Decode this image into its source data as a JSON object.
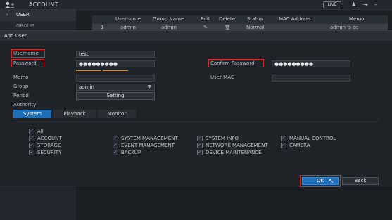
{
  "topbar": {
    "title": "ACCOUNT",
    "live_badge": "LIVE",
    "icons": [
      "account-icon",
      "user-icon",
      "exit-icon",
      "minimize-icon"
    ]
  },
  "sidebar": {
    "items": [
      {
        "label": "USER",
        "chevron": "›"
      },
      {
        "label": "GROUP"
      }
    ]
  },
  "bg_table": {
    "columns": [
      "",
      "Username",
      "Group Name",
      "Edit",
      "Delete",
      "Status",
      "MAC Address",
      "Memo"
    ],
    "rows": [
      [
        "1",
        "admin",
        "admin",
        "✎",
        "🗑",
        "Normal",
        "",
        "admin 's ac"
      ]
    ]
  },
  "dialog": {
    "title": "Add User",
    "labels": {
      "username": "Username",
      "password": "Password",
      "memo": "Memo",
      "group": "Group",
      "period": "Period",
      "authority": "Authority",
      "confirm_password": "Confirm Password",
      "user_mac": "User MAC"
    },
    "values": {
      "username": "test",
      "password": "●●●●●●●●●",
      "confirm_password": "●●●●●●●●●",
      "memo": "",
      "group": "admin",
      "user_mac": ""
    },
    "period_button": "Setting",
    "tabs": [
      "System",
      "Playback",
      "Monitor"
    ],
    "active_tab": "System",
    "permissions": [
      {
        "label": "All",
        "checked": true
      },
      {
        "label": "ACCOUNT",
        "checked": true
      },
      {
        "label": "SYSTEM MANAGEMENT",
        "checked": true
      },
      {
        "label": "SYSTEM INFO",
        "checked": true
      },
      {
        "label": "MANUAL CONTROL",
        "checked": true
      },
      {
        "label": "STORAGE",
        "checked": true
      },
      {
        "label": "EVENT MANAGEMENT",
        "checked": true
      },
      {
        "label": "NETWORK MANAGEMENT",
        "checked": true
      },
      {
        "label": "CAMERA",
        "checked": true
      },
      {
        "label": "SECURITY",
        "checked": true
      },
      {
        "label": "BACKUP",
        "checked": true
      },
      {
        "label": "DEVICE MAINTENANCE",
        "checked": true
      }
    ],
    "buttons": {
      "ok": "OK",
      "back": "Back"
    }
  },
  "colors": {
    "accent": "#1e6fb8",
    "highlight": "#d8262a",
    "background": "#1f2328"
  }
}
